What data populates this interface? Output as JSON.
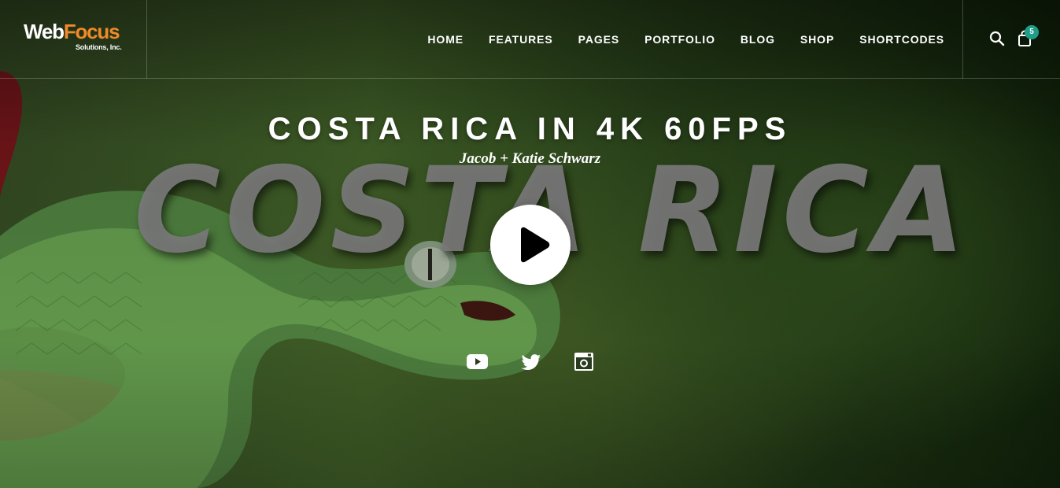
{
  "logo": {
    "word_1": "Web",
    "word_2": "Focus",
    "tagline": "Solutions, Inc."
  },
  "nav": {
    "items": [
      {
        "label": "HOME"
      },
      {
        "label": "FEATURES"
      },
      {
        "label": "PAGES"
      },
      {
        "label": "PORTFOLIO"
      },
      {
        "label": "BLOG"
      },
      {
        "label": "SHOP"
      },
      {
        "label": "SHORTCODES"
      }
    ]
  },
  "header_tools": {
    "search_icon": "search-icon",
    "cart_icon": "shopping-bag-icon",
    "cart_count": "5"
  },
  "hero": {
    "title": "COSTA RICA IN 4K 60FPS",
    "subtitle": "Jacob + Katie Schwarz",
    "brush_title": "COSTA RICA",
    "play_icon": "play-icon"
  },
  "social": [
    {
      "icon": "youtube-icon"
    },
    {
      "icon": "twitter-icon"
    },
    {
      "icon": "instagram-icon"
    }
  ],
  "colors": {
    "accent_orange": "#f08a2a",
    "badge_teal": "#1f9e8a",
    "brush_text_gray": "#787878"
  }
}
